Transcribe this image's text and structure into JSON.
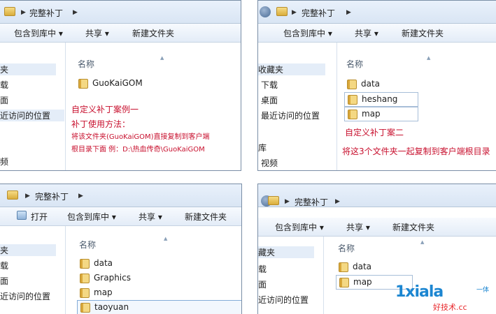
{
  "panels": [
    {
      "address": "完整补丁",
      "toolbar": [
        "包含到库中 ▾",
        "共享 ▾",
        "新建文件夹"
      ],
      "nav": [
        "夹",
        "载",
        "面",
        "近访问的位置",
        "",
        "",
        "",
        "",
        "频"
      ],
      "column_header": "名称",
      "files": [
        "GuoKaiGOM"
      ],
      "notes": [
        "自定义补丁案例一",
        "补丁使用方法：",
        "将该文件夹(GuoKaiGOM)直接复制到客户端",
        "根目录下面 例：D:\\热血传奇\\GuoKaiGOM"
      ]
    },
    {
      "address": "完整补丁",
      "toolbar": [
        "包含到库中 ▾",
        "共享 ▾",
        "新建文件夹"
      ],
      "nav": [
        "收藏夹",
        "下载",
        "桌面",
        "最近访问的位置",
        "",
        "",
        "库",
        "视频"
      ],
      "column_header": "名称",
      "files": [
        "data",
        "heshang",
        "map"
      ],
      "notes": [
        "自定义补丁案二",
        "将这3个文件夹一起复制到客户端根目录"
      ]
    },
    {
      "address": "完整补丁",
      "toolbar": [
        "打开",
        "包含到库中 ▾",
        "共享 ▾",
        "新建文件夹"
      ],
      "nav": [
        "夹",
        "载",
        "面",
        "近访问的位置"
      ],
      "column_header": "名称",
      "files": [
        "data",
        "Graphics",
        "map",
        "taoyuan"
      ]
    },
    {
      "address": "完整补丁",
      "toolbar": [
        "包含到库中 ▾",
        "共享 ▾",
        "新建文件夹"
      ],
      "nav": [
        "藏夹",
        "载",
        "面",
        "近访问的位置"
      ],
      "column_header": "名称",
      "files": [
        "data",
        "map"
      ]
    }
  ],
  "watermark": {
    "logo": "1xiala",
    "tag": "一体",
    "url": "好技术.cc"
  }
}
